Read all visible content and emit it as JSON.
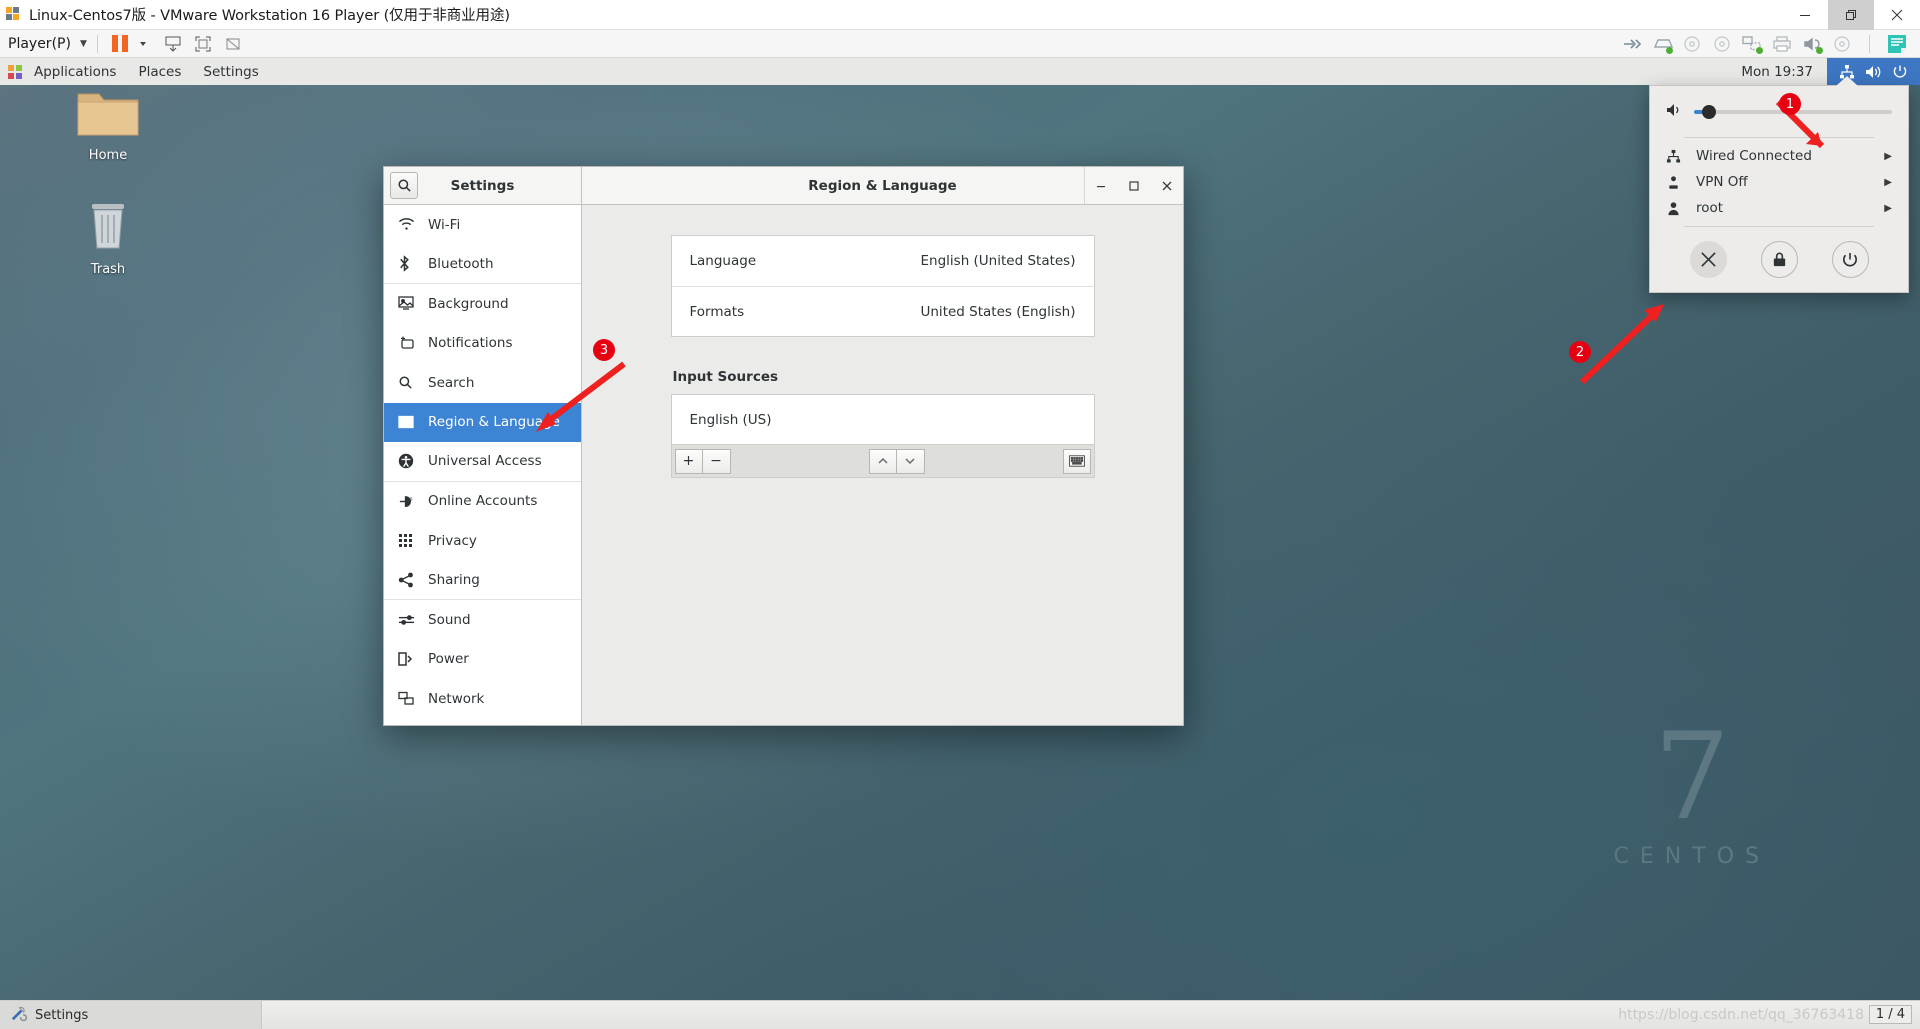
{
  "vmware": {
    "title": "Linux-Centos7版 - VMware Workstation 16 Player (仅用于非商业用途)",
    "title_icon": "vmware-logo-icon",
    "caption": {
      "minimize": "minimize-icon",
      "restore": "restore-icon",
      "close": "close-icon"
    },
    "toolbar": {
      "player_menu": "Player(P)",
      "caret": "▾",
      "pause_label": "pause-button",
      "buttons": [
        "unity-mode-icon",
        "fullscreen-icon",
        "stretch-icon"
      ],
      "status_icons": [
        "usb-icon",
        "hard-disk-icon",
        "cd-drive-icon",
        "cd-drive-2-icon",
        "network-adapter-icon",
        "printer-icon",
        "sound-card-icon",
        "disc-icon"
      ],
      "notes_icon": "notes-icon"
    }
  },
  "gnome": {
    "topbar": {
      "apps_icon": "applications-icon",
      "items": [
        "Applications",
        "Places",
        "Settings"
      ],
      "clock": "Mon 19:37",
      "status_icons": [
        "network-wired-icon",
        "volume-icon",
        "power-icon"
      ]
    },
    "desktop_icons": [
      {
        "name": "Home",
        "icon": "home-folder-icon"
      },
      {
        "name": "Trash",
        "icon": "trash-icon"
      }
    ],
    "watermark": {
      "number": "7",
      "word": "CENTOS"
    },
    "system_menu": {
      "volume_icon": "volume-icon",
      "volume_percent": 4,
      "rows": [
        {
          "icon": "network-wired-icon",
          "label": "Wired Connected",
          "chevron": "▶"
        },
        {
          "icon": "vpn-icon",
          "label": "VPN Off",
          "chevron": "▶"
        },
        {
          "icon": "user-icon",
          "label": "root",
          "chevron": "▶"
        }
      ],
      "actions": [
        {
          "icon": "settings-tools-icon",
          "name": "settings-button"
        },
        {
          "icon": "lock-icon",
          "name": "lock-button"
        },
        {
          "icon": "power-icon",
          "name": "power-button"
        }
      ]
    }
  },
  "settings_window": {
    "search_icon": "search-icon",
    "sidebar_title": "Settings",
    "page_title": "Region & Language",
    "window_buttons": {
      "minimize": "–",
      "maximize": "□",
      "close": "✕"
    },
    "sidebar_items": [
      {
        "label": "Wi-Fi",
        "icon": "wifi-icon",
        "selected": false,
        "separator": false
      },
      {
        "label": "Bluetooth",
        "icon": "bluetooth-icon",
        "selected": false,
        "separator": true
      },
      {
        "label": "Background",
        "icon": "background-icon",
        "selected": false,
        "separator": false
      },
      {
        "label": "Notifications",
        "icon": "notifications-icon",
        "selected": false,
        "separator": false
      },
      {
        "label": "Search",
        "icon": "search-icon",
        "selected": false,
        "separator": false
      },
      {
        "label": "Region & Language",
        "icon": "region-language-icon",
        "selected": true,
        "separator": false
      },
      {
        "label": "Universal Access",
        "icon": "universal-access-icon",
        "selected": false,
        "separator": true
      },
      {
        "label": "Online Accounts",
        "icon": "online-accounts-icon",
        "selected": false,
        "separator": false
      },
      {
        "label": "Privacy",
        "icon": "privacy-icon",
        "selected": false,
        "separator": false
      },
      {
        "label": "Sharing",
        "icon": "sharing-icon",
        "selected": false,
        "separator": true
      },
      {
        "label": "Sound",
        "icon": "sound-icon",
        "selected": false,
        "separator": false
      },
      {
        "label": "Power",
        "icon": "power-battery-icon",
        "selected": false,
        "separator": false
      },
      {
        "label": "Network",
        "icon": "network-icon",
        "selected": false,
        "separator": false
      }
    ],
    "rows": [
      {
        "label": "Language",
        "value": "English (United States)"
      },
      {
        "label": "Formats",
        "value": "United States (English)"
      }
    ],
    "input_sources": {
      "title": "Input Sources",
      "items": [
        "English (US)"
      ],
      "buttons": {
        "add": "+",
        "remove": "−",
        "up": "⌃",
        "down": "⌄",
        "keyboard": "keyboard-icon"
      }
    }
  },
  "annotations": [
    {
      "number": "1"
    },
    {
      "number": "2"
    },
    {
      "number": "3"
    }
  ],
  "taskbar": {
    "item": {
      "label": "Settings",
      "icon": "settings-tools-icon"
    },
    "watermark": "https://blog.csdn.net/qq_36763418",
    "page_indicator": "1 / 4"
  },
  "colors": {
    "accent_blue": "#3d84d4",
    "status_blue": "#3d76c2",
    "annotation_red": "#e60012",
    "vmware_orange": "#f26522"
  }
}
